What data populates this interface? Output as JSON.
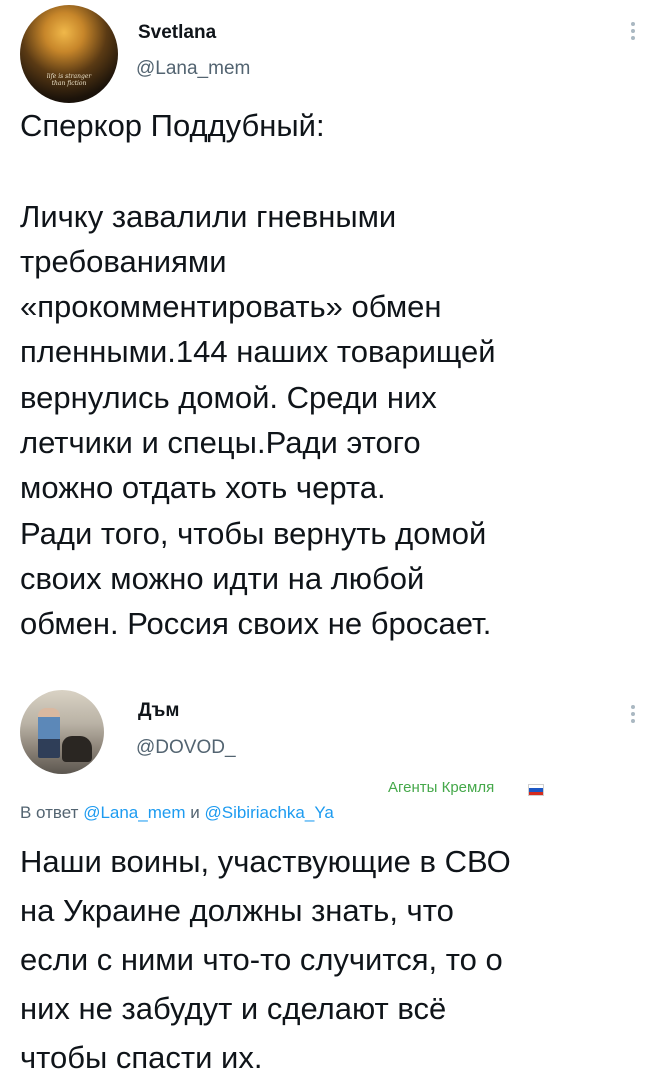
{
  "tweets": [
    {
      "display_name": "Svetlana",
      "handle": "@Lana_mem",
      "avatar_caption": "life is stranger than fiction",
      "avatar_icon": "avatar-portrait-icon",
      "text": "Сперкор Поддубный:\n\nЛичку завалили гневными\nтребованиями\n«прокомментировать» обмен\nпленными.144 наших товарищей\nвернулись домой. Среди них\nлетчики и спецы.Ради этого\nможно отдать хоть черта.\nРади того, чтобы вернуть домой\nсвоих можно идти на любой\nобмен. Россия своих не бросает."
    },
    {
      "display_name": "Дъм",
      "handle": "@DOVOD_",
      "avatar_icon": "avatar-photo-icon",
      "label": "Агенты Кремля",
      "label_flag": "russia-flag-icon",
      "reply_prefix": "В ответ",
      "reply_to_1": "@Lana_mem",
      "reply_and": "и",
      "reply_to_2": "@Sibiriachka_Ya",
      "text": "Наши воины, участвующие в СВО\nна Украине должны знать, что\nесли с ними что-то случится, то о\nних не забудут и сделают всё\nчтобы спасти их."
    }
  ],
  "colors": {
    "text": "#0f1419",
    "secondary": "#536471",
    "link": "#1d9bf0",
    "label": "#45a84a"
  }
}
